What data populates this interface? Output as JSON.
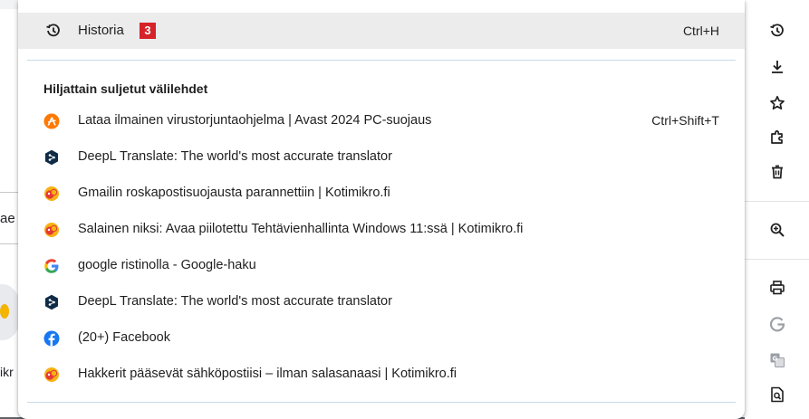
{
  "background": {
    "input_fragment": "ae",
    "label_fragment": "ikr"
  },
  "history_menu": {
    "title": "Historia",
    "badge": "3",
    "shortcut": "Ctrl+H",
    "section_heading": "Hiljattain suljetut välilehdet",
    "items": [
      {
        "title": "Lataa ilmainen virustorjuntaohjelma | Avast 2024 PC-suojaus",
        "shortcut": "Ctrl+Shift+T",
        "icon": "avast-icon"
      },
      {
        "title": "DeepL Translate: The world's most accurate translator",
        "shortcut": "",
        "icon": "deepl-icon"
      },
      {
        "title": "Gmailin roskapostisuojausta parannettiin | Kotimikro.fi",
        "shortcut": "",
        "icon": "kotimikro-icon"
      },
      {
        "title": "Salainen niksi: Avaa piilotettu Tehtävienhallinta Windows 11:ssä | Kotimikro.fi",
        "shortcut": "",
        "icon": "kotimikro-icon"
      },
      {
        "title": "google ristinolla - Google-haku",
        "shortcut": "",
        "icon": "google-icon"
      },
      {
        "title": "DeepL Translate: The world's most accurate translator",
        "shortcut": "",
        "icon": "deepl-icon"
      },
      {
        "title": "(20+) Facebook",
        "shortcut": "",
        "icon": "facebook-icon"
      },
      {
        "title": "Hakkerit pääsevät sähköpostiisi – ilman salasanaasi | Kotimikro.fi",
        "shortcut": "",
        "icon": "kotimikro-icon"
      }
    ]
  },
  "main_menu_icons": [
    "history-icon",
    "download-icon",
    "star-icon",
    "extensions-icon",
    "delete-icon",
    "zoom-icon",
    "print-icon",
    "google-lens-icon",
    "translate-icon",
    "find-icon"
  ],
  "colors": {
    "badge": "#d6232a",
    "header_bg": "#ececec",
    "separator": "#c9dbe8",
    "avast": "#ff7800",
    "deepl": "#0f2b46",
    "facebook": "#1877f2"
  }
}
